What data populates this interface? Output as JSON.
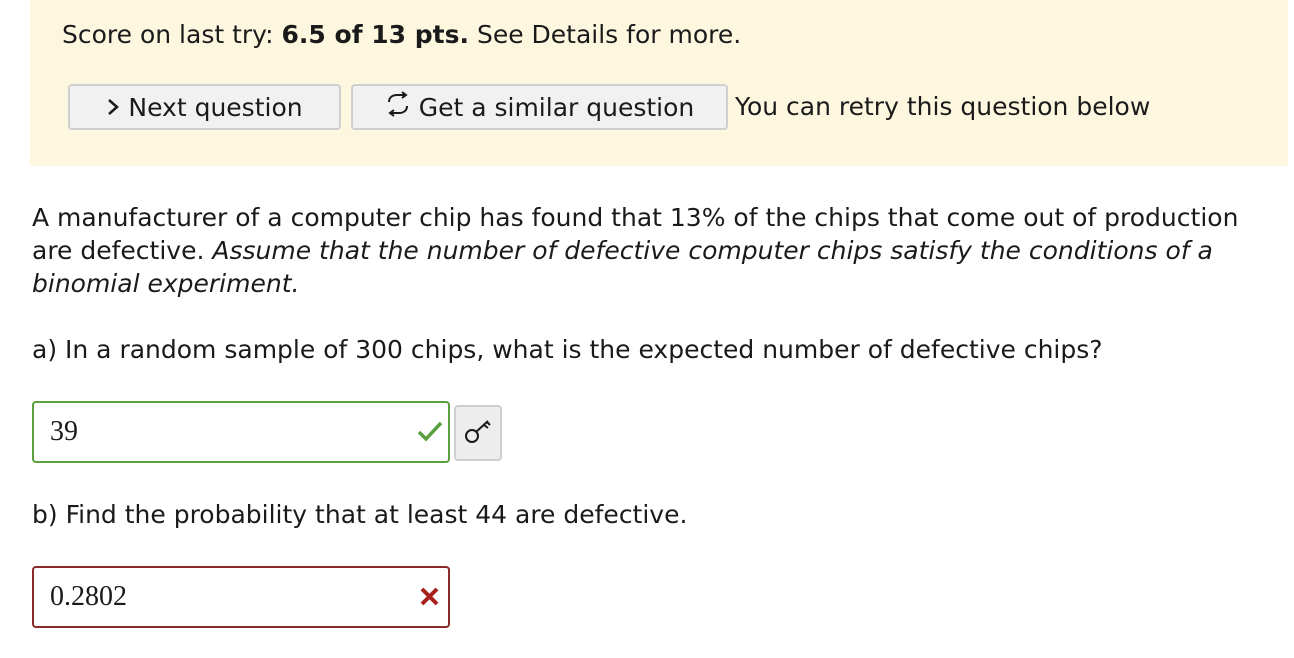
{
  "score_banner": {
    "prefix": "Score on last try: ",
    "score": "6.5 of 13 pts.",
    "suffix": " See Details for more.",
    "next_question_label": "Next question",
    "next_question_icon": "chevron-right-icon",
    "similar_question_label": "Get a similar question",
    "similar_question_icon": "retry-arrows-icon",
    "retry_note": "You can retry this question below",
    "background_color": "#fef7e0"
  },
  "problem": {
    "statement": "A manufacturer of a computer chip has found that 13% of the chips that come out of production are defective. ",
    "assumption": "Assume that the number of defective computer chips satisfy the conditions of a binomial experiment."
  },
  "part_a": {
    "question": "a) In a random sample of 300 chips, what is the expected number of defective chips?",
    "answer_value": "39",
    "status": "correct",
    "status_icon": "checkmark-icon",
    "status_color": "#5aa03e",
    "key_button_icon": "key-icon"
  },
  "part_b": {
    "question": "b) Find the probability that at least 44 are defective.",
    "answer_value": "0.2802",
    "status": "incorrect",
    "status_icon": "x-mark-icon",
    "status_color": "#a8201a"
  }
}
